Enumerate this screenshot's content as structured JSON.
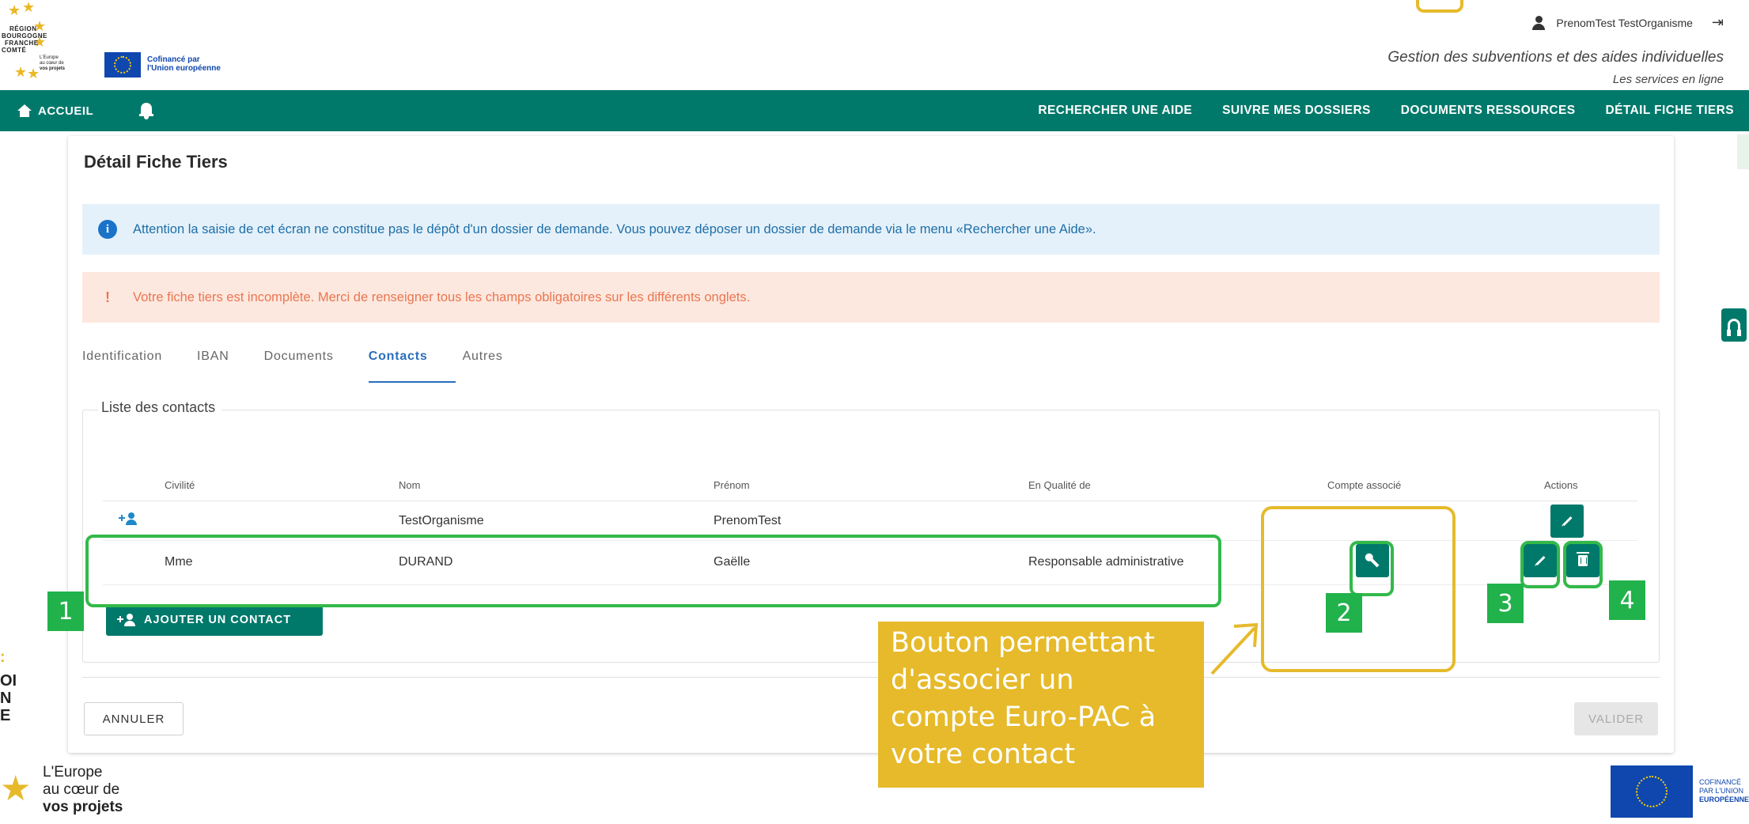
{
  "header": {
    "region_logo_lines": [
      "RÉGION",
      "BOURGOGNE",
      "FRANCHE",
      "COMTÉ"
    ],
    "europe_mini_lines": [
      "L'Europe",
      "au cœur de",
      "vos projets"
    ],
    "cofinance_lines": [
      "Cofinancé par",
      "l'Union européenne"
    ],
    "user_name": "PrenomTest TestOrganisme",
    "subtitle": "Gestion des subventions et des aides individuelles",
    "subtitle2": "Les services en ligne"
  },
  "nav": {
    "home_label": "ACCUEIL",
    "links": [
      "RECHERCHER UNE AIDE",
      "SUIVRE MES DOSSIERS",
      "DOCUMENTS RESSOURCES",
      "DÉTAIL FICHE TIERS"
    ]
  },
  "page": {
    "title": "Détail Fiche Tiers",
    "info_alert": "Attention la saisie de cet écran ne constitue pas le dépôt d'un dossier de demande. Vous pouvez déposer un dossier de demande via le menu «Rechercher une Aide».",
    "warning_alert": "Votre fiche tiers est incomplète. Merci de renseigner tous les champs obligatoires sur les différents onglets.",
    "tabs": [
      {
        "label": "Identification",
        "active": false
      },
      {
        "label": "IBAN",
        "active": false
      },
      {
        "label": "Documents",
        "active": false
      },
      {
        "label": "Contacts",
        "active": true
      },
      {
        "label": "Autres",
        "active": false
      }
    ],
    "fieldset_legend": "Liste des contacts",
    "table": {
      "headers": [
        "Civilité",
        "Nom",
        "Prénom",
        "En Qualité de",
        "Compte associé",
        "Actions"
      ],
      "rows": [
        {
          "civilite": "",
          "nom": "TestOrganisme",
          "prenom": "PrenomTest",
          "qualite": ""
        },
        {
          "civilite": "Mme",
          "nom": "DURAND",
          "prenom": "Gaëlle",
          "qualite": "Responsable administrative"
        }
      ]
    },
    "add_contact_label": "AJOUTER UN CONTACT",
    "cancel_label": "ANNULER",
    "validate_label": "VALIDER"
  },
  "annotations": {
    "badges": [
      "1",
      "2",
      "3",
      "4"
    ],
    "callout_lines": [
      "Bouton permettant",
      "d'associer un",
      "compte Euro-PAC à",
      "votre contact"
    ]
  },
  "footer": {
    "europe_lines": [
      "L'Europe",
      "au cœur de",
      "vos projets"
    ],
    "cofinance_lines": [
      "COFINANCÉ",
      "PAR L'UNION",
      "EUROPÉENNE"
    ],
    "left_cut_lines": [
      ":",
      "OI",
      "N",
      "E"
    ]
  },
  "colors": {
    "primary": "#00796b",
    "info_bg": "#e5f1fa",
    "warn_bg": "#fde8df",
    "highlight_green": "#33b94a",
    "highlight_yellow": "#e6ba2b",
    "eu_blue": "#0f47af"
  }
}
